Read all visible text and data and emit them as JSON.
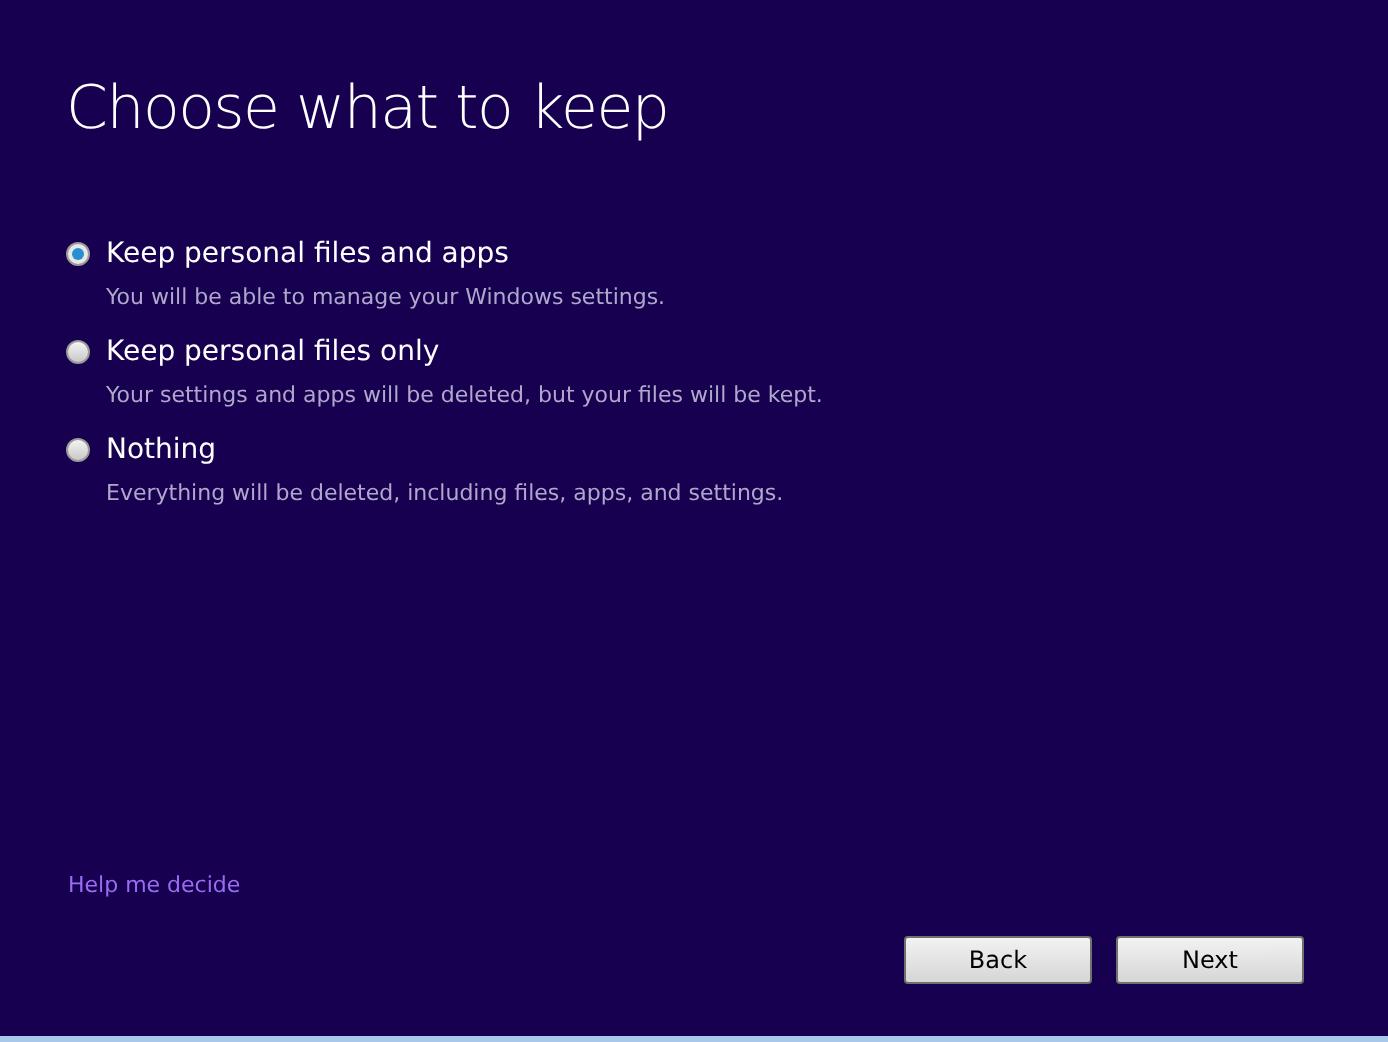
{
  "title": "Choose what to keep",
  "options": [
    {
      "label": "Keep personal files and apps",
      "description": "You will be able to manage your Windows settings.",
      "selected": true
    },
    {
      "label": "Keep personal files only",
      "description": "Your settings and apps will be deleted, but your files will be kept.",
      "selected": false
    },
    {
      "label": "Nothing",
      "description": "Everything will be deleted, including files, apps, and settings.",
      "selected": false
    }
  ],
  "help_link": "Help me decide",
  "buttons": [
    "Back",
    "Next"
  ]
}
